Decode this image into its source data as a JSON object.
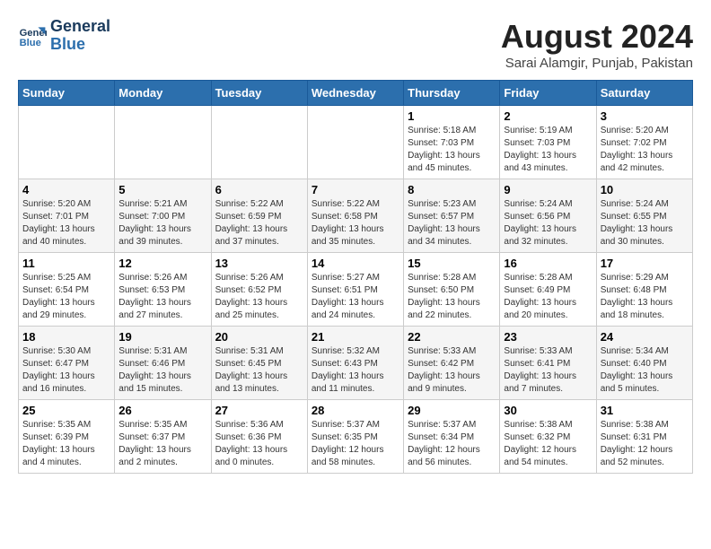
{
  "header": {
    "logo_line1": "General",
    "logo_line2": "Blue",
    "title": "August 2024",
    "subtitle": "Sarai Alamgir, Punjab, Pakistan"
  },
  "calendar": {
    "weekdays": [
      "Sunday",
      "Monday",
      "Tuesday",
      "Wednesday",
      "Thursday",
      "Friday",
      "Saturday"
    ],
    "weeks": [
      [
        {
          "day": "",
          "info": ""
        },
        {
          "day": "",
          "info": ""
        },
        {
          "day": "",
          "info": ""
        },
        {
          "day": "",
          "info": ""
        },
        {
          "day": "1",
          "info": "Sunrise: 5:18 AM\nSunset: 7:03 PM\nDaylight: 13 hours\nand 45 minutes."
        },
        {
          "day": "2",
          "info": "Sunrise: 5:19 AM\nSunset: 7:03 PM\nDaylight: 13 hours\nand 43 minutes."
        },
        {
          "day": "3",
          "info": "Sunrise: 5:20 AM\nSunset: 7:02 PM\nDaylight: 13 hours\nand 42 minutes."
        }
      ],
      [
        {
          "day": "4",
          "info": "Sunrise: 5:20 AM\nSunset: 7:01 PM\nDaylight: 13 hours\nand 40 minutes."
        },
        {
          "day": "5",
          "info": "Sunrise: 5:21 AM\nSunset: 7:00 PM\nDaylight: 13 hours\nand 39 minutes."
        },
        {
          "day": "6",
          "info": "Sunrise: 5:22 AM\nSunset: 6:59 PM\nDaylight: 13 hours\nand 37 minutes."
        },
        {
          "day": "7",
          "info": "Sunrise: 5:22 AM\nSunset: 6:58 PM\nDaylight: 13 hours\nand 35 minutes."
        },
        {
          "day": "8",
          "info": "Sunrise: 5:23 AM\nSunset: 6:57 PM\nDaylight: 13 hours\nand 34 minutes."
        },
        {
          "day": "9",
          "info": "Sunrise: 5:24 AM\nSunset: 6:56 PM\nDaylight: 13 hours\nand 32 minutes."
        },
        {
          "day": "10",
          "info": "Sunrise: 5:24 AM\nSunset: 6:55 PM\nDaylight: 13 hours\nand 30 minutes."
        }
      ],
      [
        {
          "day": "11",
          "info": "Sunrise: 5:25 AM\nSunset: 6:54 PM\nDaylight: 13 hours\nand 29 minutes."
        },
        {
          "day": "12",
          "info": "Sunrise: 5:26 AM\nSunset: 6:53 PM\nDaylight: 13 hours\nand 27 minutes."
        },
        {
          "day": "13",
          "info": "Sunrise: 5:26 AM\nSunset: 6:52 PM\nDaylight: 13 hours\nand 25 minutes."
        },
        {
          "day": "14",
          "info": "Sunrise: 5:27 AM\nSunset: 6:51 PM\nDaylight: 13 hours\nand 24 minutes."
        },
        {
          "day": "15",
          "info": "Sunrise: 5:28 AM\nSunset: 6:50 PM\nDaylight: 13 hours\nand 22 minutes."
        },
        {
          "day": "16",
          "info": "Sunrise: 5:28 AM\nSunset: 6:49 PM\nDaylight: 13 hours\nand 20 minutes."
        },
        {
          "day": "17",
          "info": "Sunrise: 5:29 AM\nSunset: 6:48 PM\nDaylight: 13 hours\nand 18 minutes."
        }
      ],
      [
        {
          "day": "18",
          "info": "Sunrise: 5:30 AM\nSunset: 6:47 PM\nDaylight: 13 hours\nand 16 minutes."
        },
        {
          "day": "19",
          "info": "Sunrise: 5:31 AM\nSunset: 6:46 PM\nDaylight: 13 hours\nand 15 minutes."
        },
        {
          "day": "20",
          "info": "Sunrise: 5:31 AM\nSunset: 6:45 PM\nDaylight: 13 hours\nand 13 minutes."
        },
        {
          "day": "21",
          "info": "Sunrise: 5:32 AM\nSunset: 6:43 PM\nDaylight: 13 hours\nand 11 minutes."
        },
        {
          "day": "22",
          "info": "Sunrise: 5:33 AM\nSunset: 6:42 PM\nDaylight: 13 hours\nand 9 minutes."
        },
        {
          "day": "23",
          "info": "Sunrise: 5:33 AM\nSunset: 6:41 PM\nDaylight: 13 hours\nand 7 minutes."
        },
        {
          "day": "24",
          "info": "Sunrise: 5:34 AM\nSunset: 6:40 PM\nDaylight: 13 hours\nand 5 minutes."
        }
      ],
      [
        {
          "day": "25",
          "info": "Sunrise: 5:35 AM\nSunset: 6:39 PM\nDaylight: 13 hours\nand 4 minutes."
        },
        {
          "day": "26",
          "info": "Sunrise: 5:35 AM\nSunset: 6:37 PM\nDaylight: 13 hours\nand 2 minutes."
        },
        {
          "day": "27",
          "info": "Sunrise: 5:36 AM\nSunset: 6:36 PM\nDaylight: 13 hours\nand 0 minutes."
        },
        {
          "day": "28",
          "info": "Sunrise: 5:37 AM\nSunset: 6:35 PM\nDaylight: 12 hours\nand 58 minutes."
        },
        {
          "day": "29",
          "info": "Sunrise: 5:37 AM\nSunset: 6:34 PM\nDaylight: 12 hours\nand 56 minutes."
        },
        {
          "day": "30",
          "info": "Sunrise: 5:38 AM\nSunset: 6:32 PM\nDaylight: 12 hours\nand 54 minutes."
        },
        {
          "day": "31",
          "info": "Sunrise: 5:38 AM\nSunset: 6:31 PM\nDaylight: 12 hours\nand 52 minutes."
        }
      ]
    ]
  }
}
